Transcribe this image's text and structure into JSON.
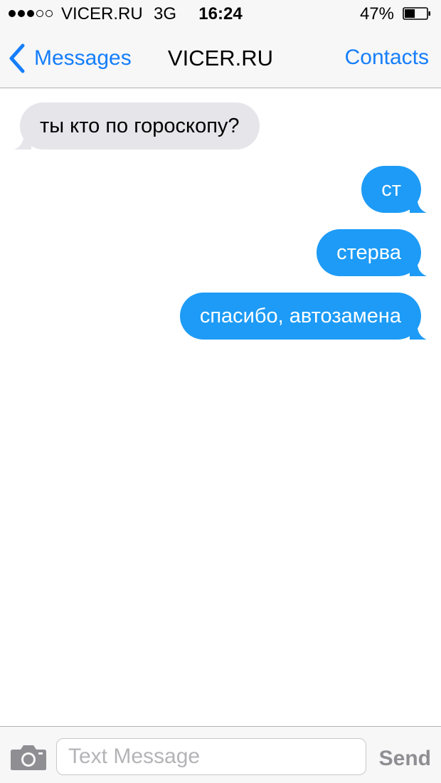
{
  "status_bar": {
    "carrier": "VICER.RU",
    "network": "3G",
    "time": "16:24",
    "battery_percent": "47%",
    "battery_level": 0.47,
    "signal_bars_filled": 3,
    "signal_bars_total": 5
  },
  "nav": {
    "back_label": "Messages",
    "title": "VICER.RU",
    "contacts_label": "Contacts",
    "accent_color": "#157efb",
    "back_icon": "chevron-left-icon"
  },
  "messages": [
    {
      "direction": "incoming",
      "text": "ты кто по гороскопу?"
    },
    {
      "direction": "outgoing",
      "text": "ст"
    },
    {
      "direction": "outgoing",
      "text": "стерва"
    },
    {
      "direction": "outgoing",
      "text": "спасибо, автозамена"
    }
  ],
  "colors": {
    "incoming_bubble": "#e5e5ea",
    "outgoing_bubble": "#1d9bf6"
  },
  "input": {
    "placeholder": "Text Message",
    "value": "",
    "send_label": "Send",
    "camera_icon": "camera-icon"
  }
}
